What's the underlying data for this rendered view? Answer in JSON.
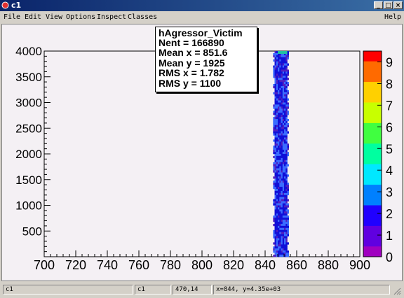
{
  "window": {
    "title": "c1",
    "min_label": "_",
    "max_label": "□",
    "close_label": "×"
  },
  "menu": {
    "file": "File",
    "edit": "Edit",
    "view": "View",
    "options": "Options",
    "inspect": "Inspect",
    "classes": "Classes",
    "help": "Help"
  },
  "stats": {
    "name": "hAgressor_Victim",
    "nent": "Nent = 166890",
    "mean_x": "Mean x =  851.6",
    "mean_y": "Mean y =   1925",
    "rms_x": "RMS x =  1.782",
    "rms_y": "RMS y =   1100"
  },
  "chart_data": {
    "type": "heatmap",
    "title": "",
    "xlabel": "",
    "ylabel": "",
    "xlim": [
      700,
      900
    ],
    "ylim": [
      0,
      4000
    ],
    "x_ticks": [
      700,
      720,
      740,
      760,
      780,
      800,
      820,
      840,
      860,
      880,
      900
    ],
    "y_ticks": [
      0,
      500,
      1000,
      1500,
      2000,
      2500,
      3000,
      3500,
      4000
    ],
    "color_scale": {
      "min": 0,
      "max": 9.5,
      "ticks": [
        0,
        1,
        2,
        3,
        4,
        5,
        6,
        7,
        8,
        9
      ]
    },
    "band": {
      "x_min": 845,
      "x_max": 855,
      "x_center": 851.6,
      "y_min": 0,
      "y_max": 4000,
      "typical_count_range": [
        1,
        4
      ],
      "hot_spot": {
        "x": 851,
        "y": 3950,
        "count": 5
      }
    }
  },
  "colors": {
    "canvas_bg": "#f4f0f4",
    "band_dark": "#1010d8",
    "band_light": "#3a6cff"
  },
  "status": {
    "cell1": "c1",
    "cell2": "c1",
    "cell3": "470,14",
    "cell4": "x=844, y=4.35e+03"
  }
}
